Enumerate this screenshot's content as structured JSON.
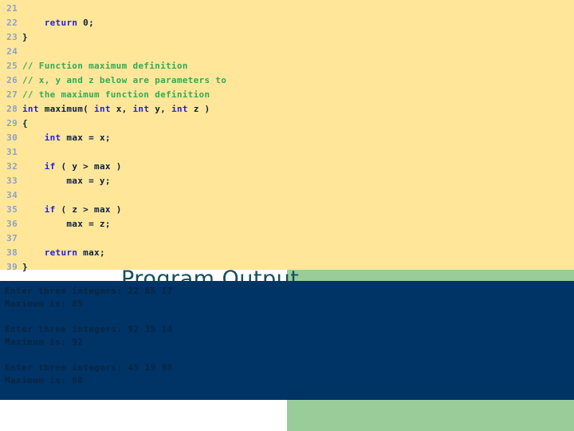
{
  "slide": {
    "title_heading": "Program Output",
    "colors": {
      "code_background": "#ffe699",
      "accent_green": "#99cc99",
      "console_background": "#003366",
      "console_text": "#0a2540",
      "keyword": "#2222dd",
      "comment": "#33aa55",
      "code_text": "#0a1f3d",
      "line_number": "#8ca3c4",
      "heading_text": "#14515c"
    }
  },
  "code": {
    "lines": [
      {
        "number": "21",
        "segments": [
          {
            "text": "",
            "style": "code-text"
          }
        ]
      },
      {
        "number": "22",
        "segments": [
          {
            "text": "    ",
            "style": "code-text"
          },
          {
            "text": "return",
            "style": "kw"
          },
          {
            "text": " 0;",
            "style": "code-text"
          }
        ]
      },
      {
        "number": "23",
        "segments": [
          {
            "text": "}",
            "style": "code-text"
          }
        ]
      },
      {
        "number": "24",
        "segments": [
          {
            "text": "",
            "style": "code-text"
          }
        ]
      },
      {
        "number": "25",
        "segments": [
          {
            "text": "// Function maximum definition",
            "style": "cmt"
          }
        ]
      },
      {
        "number": "26",
        "segments": [
          {
            "text": "// x, y and z below are parameters to",
            "style": "cmt"
          }
        ]
      },
      {
        "number": "27",
        "segments": [
          {
            "text": "// the maximum function definition",
            "style": "cmt"
          }
        ]
      },
      {
        "number": "28",
        "segments": [
          {
            "text": "int",
            "style": "kw"
          },
          {
            "text": " maximum( ",
            "style": "code-text"
          },
          {
            "text": "int",
            "style": "kw"
          },
          {
            "text": " x, ",
            "style": "code-text"
          },
          {
            "text": "int",
            "style": "kw"
          },
          {
            "text": " y, ",
            "style": "code-text"
          },
          {
            "text": "int",
            "style": "kw"
          },
          {
            "text": " z )",
            "style": "code-text"
          }
        ]
      },
      {
        "number": "29",
        "segments": [
          {
            "text": "{",
            "style": "code-text"
          }
        ]
      },
      {
        "number": "30",
        "segments": [
          {
            "text": "    ",
            "style": "code-text"
          },
          {
            "text": "int",
            "style": "kw"
          },
          {
            "text": " max = x;",
            "style": "code-text"
          }
        ]
      },
      {
        "number": "31",
        "segments": [
          {
            "text": "",
            "style": "code-text"
          }
        ]
      },
      {
        "number": "32",
        "segments": [
          {
            "text": "    ",
            "style": "code-text"
          },
          {
            "text": "if",
            "style": "kw"
          },
          {
            "text": " ( y > max )",
            "style": "code-text"
          }
        ]
      },
      {
        "number": "33",
        "segments": [
          {
            "text": "        max = y;",
            "style": "code-text"
          }
        ]
      },
      {
        "number": "34",
        "segments": [
          {
            "text": "",
            "style": "code-text"
          }
        ]
      },
      {
        "number": "35",
        "segments": [
          {
            "text": "    ",
            "style": "code-text"
          },
          {
            "text": "if",
            "style": "kw"
          },
          {
            "text": " ( z > max )",
            "style": "code-text"
          }
        ]
      },
      {
        "number": "36",
        "segments": [
          {
            "text": "        max = z;",
            "style": "code-text"
          }
        ]
      },
      {
        "number": "37",
        "segments": [
          {
            "text": "",
            "style": "code-text"
          }
        ]
      },
      {
        "number": "38",
        "segments": [
          {
            "text": "    ",
            "style": "code-text"
          },
          {
            "text": "return",
            "style": "kw"
          },
          {
            "text": " max;",
            "style": "code-text"
          }
        ]
      },
      {
        "number": "39",
        "segments": [
          {
            "text": "}",
            "style": "code-text"
          }
        ]
      }
    ]
  },
  "console": {
    "lines": [
      "Enter three integers: 22 85 17",
      "Maximum is: 85",
      "",
      "Enter three integers: 92 35 14",
      "Maximum is: 92",
      "",
      "Enter three integers: 45 19 98",
      "Maximum is: 98"
    ]
  }
}
